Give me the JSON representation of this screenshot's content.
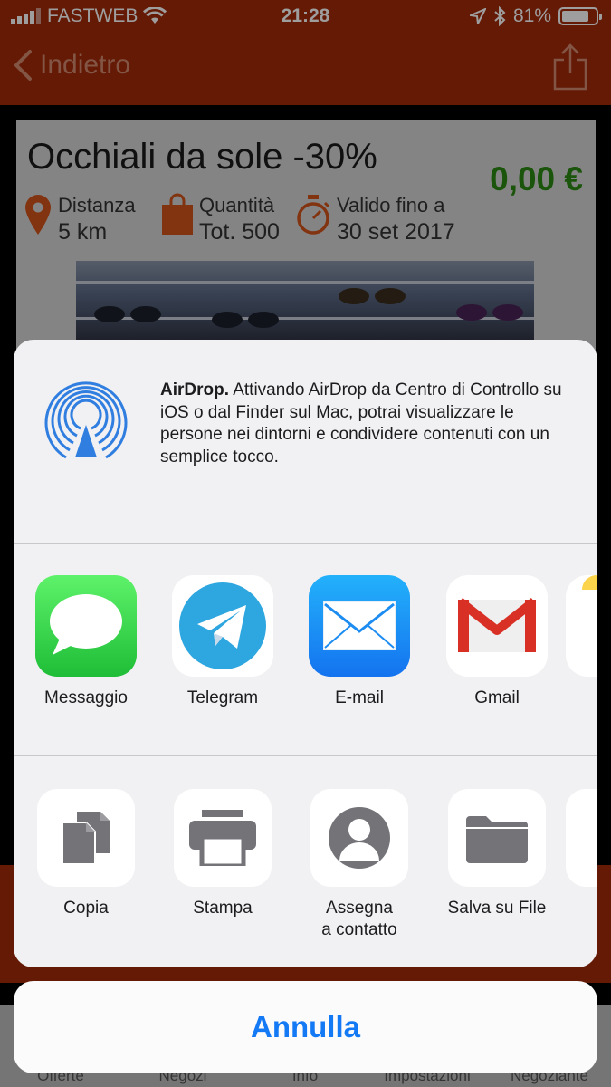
{
  "status_bar": {
    "carrier": "FASTWEB",
    "time": "21:28",
    "battery": "81%",
    "battery_level": 0.81
  },
  "nav": {
    "back_label": "Indietro"
  },
  "offer": {
    "title": "Occhiali da sole -30%",
    "price": "0,00 €",
    "distance_label": "Distanza",
    "distance_value": "5 km",
    "quantity_label": "Quantità",
    "quantity_value": "Tot. 500",
    "valid_label": "Valido fino a",
    "valid_value": "30 set 2017"
  },
  "tabs": [
    "Offerte",
    "Negozi",
    "Info",
    "Impostazioni",
    "Negoziante"
  ],
  "share_sheet": {
    "airdrop_title": "AirDrop.",
    "airdrop_body": "Attivando AirDrop da Centro di Controllo su iOS o dal Finder sul Mac, potrai visualizzare le persone nei dintorni e condividere contenuti con un semplice tocco.",
    "apps": [
      {
        "label": "Messaggio",
        "icon": "messages-icon"
      },
      {
        "label": "Telegram",
        "icon": "telegram-icon"
      },
      {
        "label": "E-mail",
        "icon": "mail-icon"
      },
      {
        "label": "Gmail",
        "icon": "gmail-icon"
      }
    ],
    "actions": [
      {
        "label": "Copia",
        "icon": "copy-icon"
      },
      {
        "label": "Stampa",
        "icon": "print-icon"
      },
      {
        "label": "Assegna\na contatto",
        "icon": "contact-icon"
      },
      {
        "label": "Salva su File",
        "icon": "folder-icon"
      }
    ],
    "cancel_label": "Annulla"
  },
  "colors": {
    "brand": "#a32b0b",
    "price_green": "#2c8a14",
    "ios_blue": "#1479f5",
    "icon_orange": "#d2531a"
  }
}
